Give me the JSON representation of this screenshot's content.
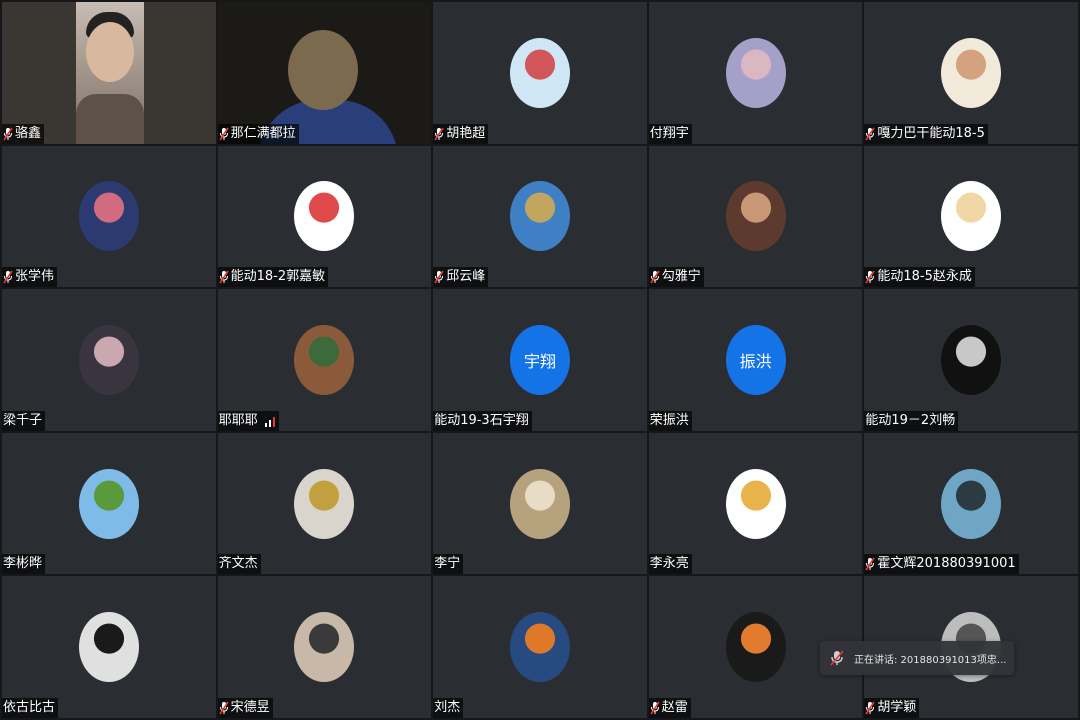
{
  "participants": [
    {
      "name": "骆鑫",
      "muted": true,
      "type": "video",
      "variant": "light"
    },
    {
      "name": "那仁满都拉",
      "muted": true,
      "type": "video",
      "variant": "dark"
    },
    {
      "name": "胡艳超",
      "muted": true,
      "type": "avatar",
      "colors": [
        "#cfe6f5",
        "#d0565a"
      ]
    },
    {
      "name": "付翔宇",
      "muted": false,
      "type": "avatar",
      "colors": [
        "#a5a0c8",
        "#d9b7c3"
      ]
    },
    {
      "name": "嘎力巴干能动18-5",
      "muted": true,
      "type": "avatar",
      "colors": [
        "#f1e9da",
        "#d4a27e"
      ]
    },
    {
      "name": "张学伟",
      "muted": true,
      "type": "avatar",
      "colors": [
        "#2c3a72",
        "#d26b7e"
      ]
    },
    {
      "name": "能动18-2郭嘉敏",
      "muted": true,
      "type": "avatar",
      "colors": [
        "#ffffff",
        "#e14a4a"
      ]
    },
    {
      "name": "邱云峰",
      "muted": true,
      "type": "avatar",
      "colors": [
        "#3f7fc4",
        "#c2a55f"
      ]
    },
    {
      "name": "勾雅宁",
      "muted": true,
      "type": "avatar",
      "colors": [
        "#5c3b2e",
        "#c89776"
      ]
    },
    {
      "name": "能动18-5赵永成",
      "muted": true,
      "type": "avatar",
      "colors": [
        "#ffffff",
        "#f2d7a6"
      ]
    },
    {
      "name": "梁千子",
      "muted": false,
      "type": "avatar",
      "colors": [
        "#3a3440",
        "#c9a8b0"
      ]
    },
    {
      "name": "耶耶耶",
      "muted": false,
      "type": "avatar",
      "signal": true,
      "colors": [
        "#8b5a3a",
        "#3c6a3a"
      ]
    },
    {
      "name": "能动19-3石宇翔",
      "muted": false,
      "type": "text",
      "initials": "宇翔"
    },
    {
      "name": "荣振洪",
      "muted": false,
      "type": "text",
      "initials": "振洪"
    },
    {
      "name": "能动19－2刘畅",
      "muted": false,
      "type": "avatar",
      "colors": [
        "#111111",
        "#c8c8c8"
      ]
    },
    {
      "name": "李彬晔",
      "muted": false,
      "type": "avatar",
      "colors": [
        "#7fbbe9",
        "#5a9a3c"
      ]
    },
    {
      "name": "齐文杰",
      "muted": false,
      "type": "avatar",
      "colors": [
        "#d9d4cc",
        "#c2a040"
      ]
    },
    {
      "name": "李宁",
      "muted": false,
      "type": "avatar",
      "colors": [
        "#b7a27e",
        "#e8dcc6"
      ]
    },
    {
      "name": "李永亮",
      "muted": false,
      "type": "avatar",
      "colors": [
        "#ffffff",
        "#e7b34a"
      ]
    },
    {
      "name": "霍文辉201880391001",
      "muted": true,
      "type": "avatar",
      "colors": [
        "#6fa6c6",
        "#2c3a42"
      ]
    },
    {
      "name": "依古比古",
      "muted": false,
      "type": "avatar",
      "colors": [
        "#e0e0e0",
        "#1a1a1a"
      ]
    },
    {
      "name": "宋德昱",
      "muted": true,
      "type": "avatar",
      "colors": [
        "#c7b8a8",
        "#3a3a3a"
      ]
    },
    {
      "name": "刘杰",
      "muted": false,
      "type": "avatar",
      "colors": [
        "#274a80",
        "#e0782a"
      ]
    },
    {
      "name": "赵雷",
      "muted": true,
      "type": "avatar",
      "colors": [
        "#1a1a1a",
        "#e27b2f"
      ]
    },
    {
      "name": "胡学颖",
      "muted": true,
      "type": "avatar",
      "colors": [
        "#bdbdbd",
        "#555555"
      ]
    }
  ],
  "speaking_toast": {
    "text": "正在讲话: 201880391013项忠..."
  },
  "colors": {
    "mic_muted": "#e53935",
    "avatar_text_bg": "#1473e6",
    "signal_bar": "#e53935"
  }
}
